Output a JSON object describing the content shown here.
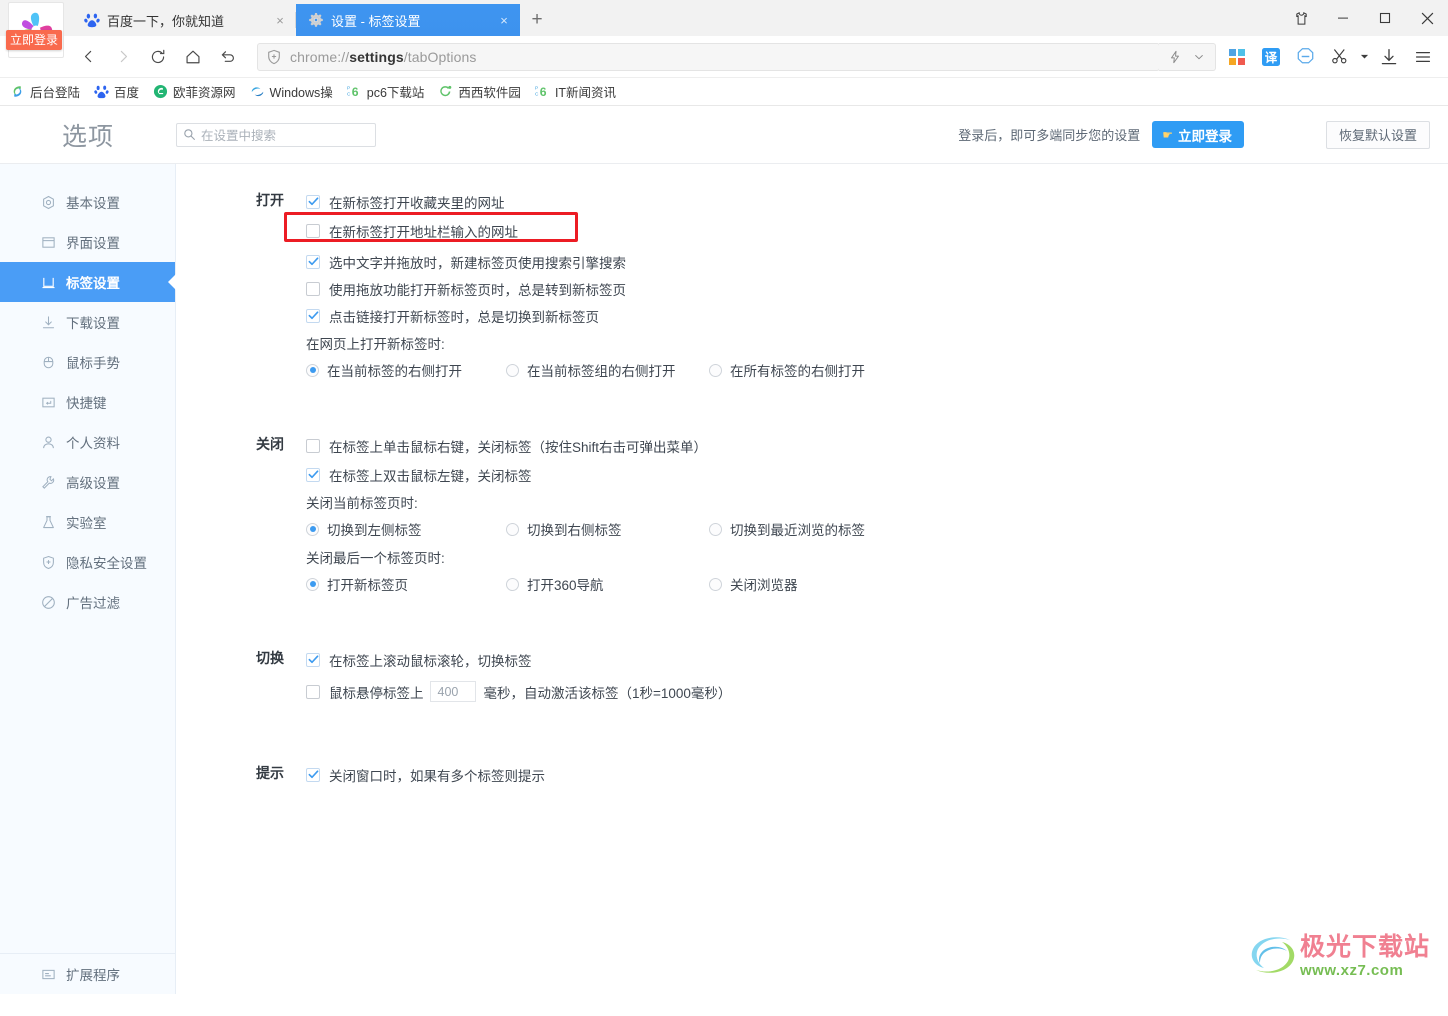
{
  "window": {
    "controls": [
      {
        "name": "skin-icon",
        "label": "皮肤"
      },
      {
        "name": "minimize-icon",
        "label": "最小化"
      },
      {
        "name": "maximize-icon",
        "label": "最大化"
      },
      {
        "name": "close-icon",
        "label": "关闭"
      }
    ]
  },
  "browser": {
    "login_badge": "立即登录",
    "tabs": [
      {
        "title": "百度一下，你就知道",
        "favicon": "baidu-icon",
        "active": false,
        "close": "×"
      },
      {
        "title": "设置 - 标签设置",
        "favicon": "gear-icon",
        "active": true,
        "close": "×"
      }
    ],
    "new_tab_label": "+",
    "address": {
      "prefix": "chrome://",
      "bold": "settings",
      "suffix": "/tabOptions",
      "full": "chrome://settings/tabOptions"
    },
    "nav": {
      "back": "back-icon",
      "forward": "forward-icon",
      "reload": "reload-icon",
      "home": "home-icon",
      "undo": "undo-icon"
    },
    "toolbar_icons": [
      "lightning-icon",
      "chevron-down-icon",
      "windows-apps-icon",
      "translate-icon",
      "adblock-icon",
      "screenshot-scissors-icon",
      "scissors-dropdown-icon",
      "download-icon",
      "menu-icon"
    ],
    "translate_label": "译",
    "bookmarks": [
      {
        "label": "后台登陆",
        "icon": "swirl-icon"
      },
      {
        "label": "百度",
        "icon": "baidu-icon"
      },
      {
        "label": "欧菲资源网",
        "icon": "green-circle-icon"
      },
      {
        "label": "Windows操",
        "icon": "windows-blue-icon"
      },
      {
        "label": "pc6下载站",
        "icon": "pc6-icon"
      },
      {
        "label": "西西软件园",
        "icon": "green-c-icon"
      },
      {
        "label": "IT新闻资讯",
        "icon": "pc6-icon"
      }
    ]
  },
  "settings": {
    "page_title": "选项",
    "search": {
      "placeholder": "在设置中搜索",
      "value": "",
      "icon": "search-icon"
    },
    "sync_hint": "登录后，即可多端同步您的设置",
    "login_button": "立即登录",
    "reset_button": "恢复默认设置",
    "sidebar": {
      "items": [
        {
          "label": "基本设置",
          "icon": "circle-target-icon",
          "active": false
        },
        {
          "label": "界面设置",
          "icon": "window-icon",
          "active": false
        },
        {
          "label": "标签设置",
          "icon": "tab-icon",
          "active": true
        },
        {
          "label": "下载设置",
          "icon": "download-arrow-icon",
          "active": false
        },
        {
          "label": "鼠标手势",
          "icon": "mouse-icon",
          "active": false
        },
        {
          "label": "快捷键",
          "icon": "keyboard-key-icon",
          "active": false
        },
        {
          "label": "个人资料",
          "icon": "person-icon",
          "active": false
        },
        {
          "label": "高级设置",
          "icon": "wrench-icon",
          "active": false
        },
        {
          "label": "实验室",
          "icon": "flask-icon",
          "active": false
        },
        {
          "label": "隐私安全设置",
          "icon": "shield-plus-icon",
          "active": false
        },
        {
          "label": "广告过滤",
          "icon": "ban-icon",
          "active": false
        }
      ],
      "bottom_item": {
        "label": "扩展程序",
        "icon": "extension-icon"
      }
    },
    "groups": [
      {
        "title": "打开",
        "checkboxes": [
          {
            "label": "在新标签打开收藏夹里的网址",
            "checked": true,
            "highlighted": false
          },
          {
            "label": "在新标签打开地址栏输入的网址",
            "checked": false,
            "highlighted": true
          },
          {
            "label": "选中文字并拖放时，新建标签页使用搜索引擎搜索",
            "checked": true,
            "highlighted": false
          },
          {
            "label": "使用拖放功能打开新标签页时，总是转到新标签页",
            "checked": false,
            "highlighted": false
          },
          {
            "label": "点击链接打开新标签时，总是切换到新标签页",
            "checked": true,
            "highlighted": false
          }
        ],
        "radio_groups": [
          {
            "caption": "在网页上打开新标签时:",
            "options": [
              {
                "label": "在当前标签的右侧打开",
                "selected": true
              },
              {
                "label": "在当前标签组的右侧打开",
                "selected": false
              },
              {
                "label": "在所有标签的右侧打开",
                "selected": false
              }
            ]
          }
        ]
      },
      {
        "title": "关闭",
        "checkboxes": [
          {
            "label": "在标签上单击鼠标右键，关闭标签（按住Shift右击可弹出菜单）",
            "checked": false,
            "highlighted": false
          },
          {
            "label": "在标签上双击鼠标左键，关闭标签",
            "checked": true,
            "highlighted": false
          }
        ],
        "radio_groups": [
          {
            "caption": "关闭当前标签页时:",
            "options": [
              {
                "label": "切换到左侧标签",
                "selected": true
              },
              {
                "label": "切换到右侧标签",
                "selected": false
              },
              {
                "label": "切换到最近浏览的标签",
                "selected": false
              }
            ]
          },
          {
            "caption": "关闭最后一个标签页时:",
            "options": [
              {
                "label": "打开新标签页",
                "selected": true
              },
              {
                "label": "打开360导航",
                "selected": false
              },
              {
                "label": "关闭浏览器",
                "selected": false
              }
            ]
          }
        ]
      },
      {
        "title": "切换",
        "checkboxes": [
          {
            "label": "在标签上滚动鼠标滚轮，切换标签",
            "checked": true,
            "highlighted": false
          }
        ],
        "hover_row": {
          "checked": false,
          "prefix": "鼠标悬停标签上",
          "input_value": "400",
          "suffix": "毫秒，自动激活该标签（1秒=1000毫秒）"
        }
      },
      {
        "title": "提示",
        "checkboxes": [
          {
            "label": "关闭窗口时，如果有多个标签则提示",
            "checked": true,
            "highlighted": false
          }
        ]
      }
    ]
  },
  "watermark": {
    "cn": "极光下载站",
    "en": "www.xz7.com"
  },
  "colors": {
    "accent": "#4a9df6",
    "tab_active": "#3d92ee",
    "login_btn": "#2f9cf4",
    "login_badge": "#f96a4d",
    "highlight": "#ec1c24",
    "sidebar_bg": "#f7fbff"
  }
}
